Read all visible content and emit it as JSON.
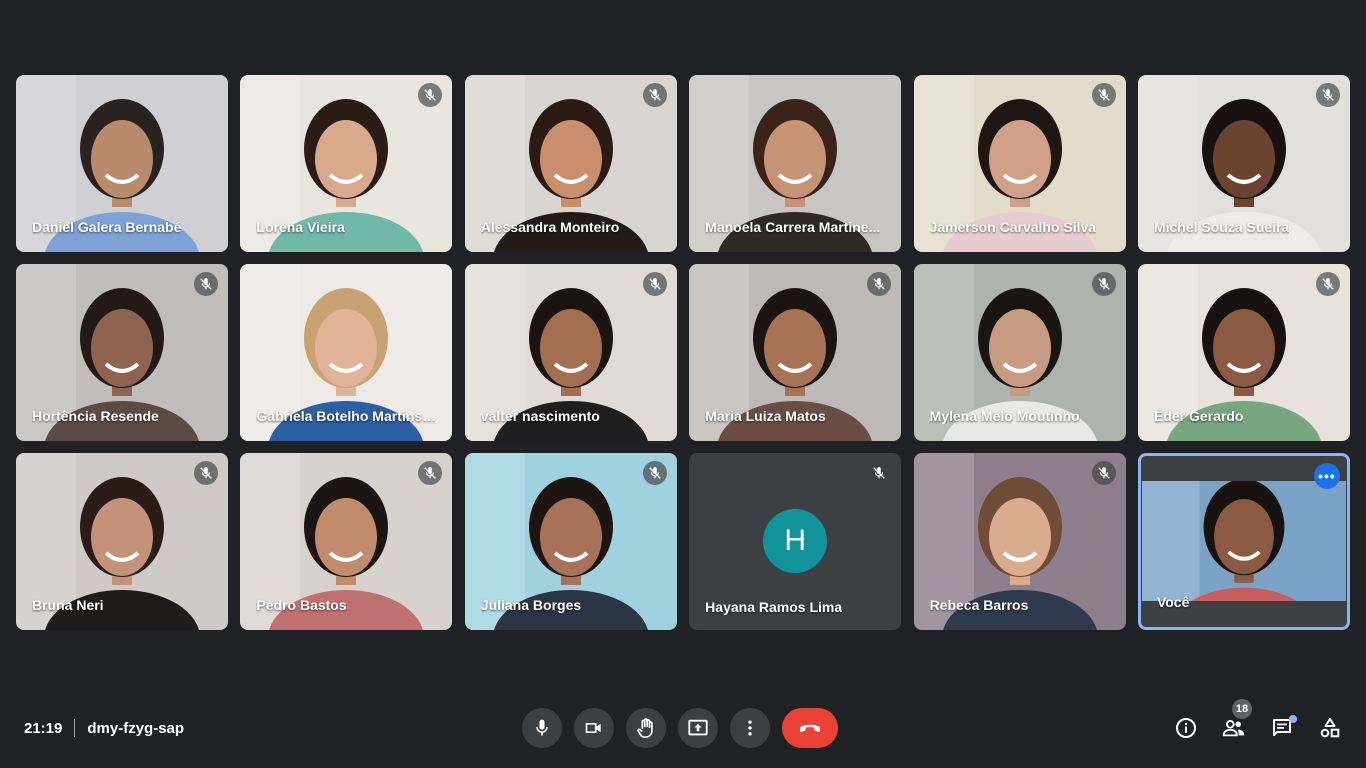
{
  "participants": [
    {
      "name": "Daniel Galera Bernabé",
      "muted": false,
      "bg": "#cfcfd4",
      "skin": "#b98a6c",
      "hair": "#2a2220",
      "shirt": "#7ea1d6"
    },
    {
      "name": "Lorena Vieira",
      "muted": true,
      "bg": "#e9e6e0",
      "skin": "#d8a98c",
      "hair": "#2b1d16",
      "shirt": "#70b8a8"
    },
    {
      "name": "Alessandra Monteiro",
      "muted": true,
      "bg": "#d9d6d1",
      "skin": "#c98e6d",
      "hair": "#2c1b14",
      "shirt": "#221b1a"
    },
    {
      "name": "Manoela Carrera Martine...",
      "muted": false,
      "bg": "#c8c6c2",
      "skin": "#c79375",
      "hair": "#3a2419",
      "shirt": "#2f2a28"
    },
    {
      "name": "Jamerson Carvalho Silva",
      "muted": true,
      "bg": "#e3dccb",
      "skin": "#d0a188",
      "hair": "#1e1713",
      "shirt": "#e6ccd1"
    },
    {
      "name": "Michel Souza Sueira",
      "muted": true,
      "bg": "#e2e0dd",
      "skin": "#6b4431",
      "hair": "#171210",
      "shirt": "#ecebe9"
    },
    {
      "name": "Hortência Resende",
      "muted": true,
      "bg": "#c0bdbb",
      "skin": "#8f6352",
      "hair": "#231916",
      "shirt": "#5c4b45"
    },
    {
      "name": "Gabriela Botelho Martins ...",
      "muted": false,
      "bg": "#ece9e6",
      "skin": "#e1b49a",
      "hair": "#c9a271",
      "shirt": "#2c5fa3"
    },
    {
      "name": "valter nascimento",
      "muted": true,
      "bg": "#e0dbd6",
      "skin": "#a36e52",
      "hair": "#1b1512",
      "shirt": "#1f1f20"
    },
    {
      "name": "Maria Luiza Matos",
      "muted": true,
      "bg": "#bcb9b6",
      "skin": "#a87256",
      "hair": "#1a1412",
      "shirt": "#6a4d45"
    },
    {
      "name": "Mylena Melo Moutinho",
      "muted": true,
      "bg": "#aeb3ad",
      "skin": "#c79a82",
      "hair": "#1b1512",
      "shirt": "#e8e8e6"
    },
    {
      "name": "Éder Gerardo",
      "muted": true,
      "bg": "#e8e2dc",
      "skin": "#8a5a42",
      "hair": "#17110f",
      "shirt": "#77a680"
    },
    {
      "name": "Bruna Neri",
      "muted": true,
      "bg": "#cfcac6",
      "skin": "#c4927a",
      "hair": "#2a1c16",
      "shirt": "#201c1c"
    },
    {
      "name": "Pedro Bastos",
      "muted": true,
      "bg": "#d8d2cd",
      "skin": "#c28b6c",
      "hair": "#1b1613",
      "shirt": "#c07070"
    },
    {
      "name": "Juliana Borges",
      "muted": true,
      "bg": "#9fd2de",
      "skin": "#a77259",
      "hair": "#1c1512",
      "shirt": "#2b3445"
    },
    {
      "name": "Hayana Ramos Lima",
      "muted": true,
      "avatar": "H"
    },
    {
      "name": "Rebeca Barros",
      "muted": true,
      "bg": "#8f7e8c",
      "skin": "#d9ab8f",
      "hair": "#6e4c35",
      "shirt": "#2f3a4e"
    },
    {
      "name": "Você",
      "self": true,
      "bg": "#7aa3c7",
      "skin": "#8a5a42",
      "hair": "#171210",
      "shirt": "#c85d5d"
    }
  ],
  "meeting": {
    "time": "21:19",
    "code": "dmy-fzyg-sap"
  },
  "controls": [
    {
      "name": "microphone-button",
      "icon": "mic-icon"
    },
    {
      "name": "camera-button",
      "icon": "video-icon"
    },
    {
      "name": "raise-hand-button",
      "icon": "hand-icon"
    },
    {
      "name": "present-button",
      "icon": "present-icon"
    },
    {
      "name": "more-options-button",
      "icon": "more-vertical-icon"
    },
    {
      "name": "leave-call-button",
      "icon": "phone-hangup-icon"
    }
  ],
  "tools": {
    "people_count": "18"
  },
  "colors": {
    "accent": "#8ab4f8",
    "end_call": "#ea4335",
    "avatar": "#12939a"
  }
}
